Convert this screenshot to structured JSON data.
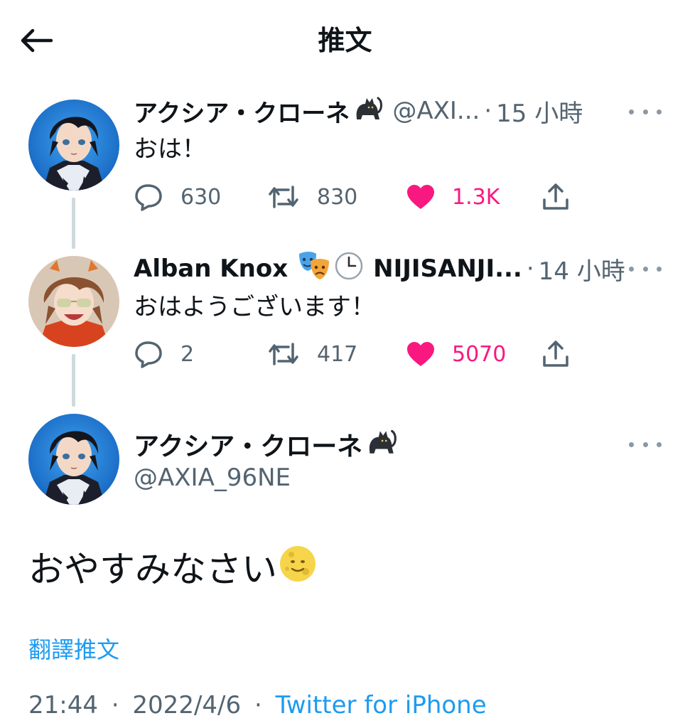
{
  "header": {
    "title": "推文",
    "back_icon": "arrow-left-icon"
  },
  "thread": [
    {
      "display_name": "アクシア・クローネ",
      "name_emoji": [
        "cat-icon"
      ],
      "handle": "@AXI...",
      "separator": "·",
      "time": "15 小時",
      "text": "おは！",
      "replies": "630",
      "retweets": "830",
      "likes": "1.3K",
      "liked": true
    },
    {
      "display_name": "Alban Knox",
      "name_emoji": [
        "performing-arts-icon",
        "clock-icon"
      ],
      "handle": "NIJISANJI...",
      "separator": "·",
      "time": "14 小時",
      "text": "おはようございます！",
      "replies": "2",
      "retweets": "417",
      "likes": "5070",
      "liked": true
    }
  ],
  "main_tweet": {
    "display_name": "アクシア・クローネ",
    "name_emoji": "cat-icon",
    "handle": "@AXIA_96NE",
    "text": "おやすみなさい",
    "text_emoji": "full-moon-face-icon",
    "translate_label": "翻譯推文",
    "time": "21:44",
    "separator": "·",
    "date": "2022/4/6",
    "source": "Twitter for iPhone"
  },
  "colors": {
    "text_primary": "#0f1419",
    "text_secondary": "#536471",
    "link": "#1d9bf0",
    "like": "#f91880",
    "thread_line": "#cfd9de",
    "avatar_blue": "#1d7fd6"
  }
}
